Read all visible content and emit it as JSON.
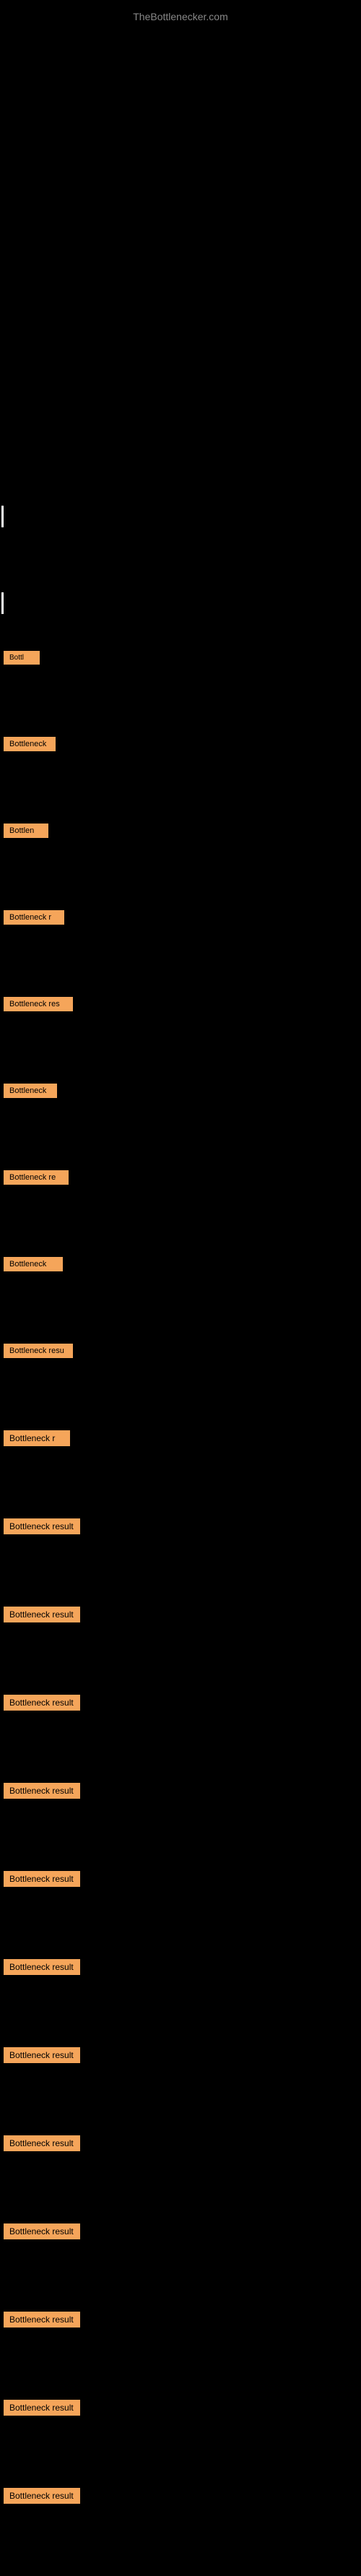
{
  "site": {
    "title": "TheBottlenecker.com"
  },
  "bottleneck_items": [
    {
      "id": 1,
      "label": "Bottl",
      "class": "item-1"
    },
    {
      "id": 2,
      "label": "Bottleneck",
      "class": "item-2"
    },
    {
      "id": 3,
      "label": "Bottlen",
      "class": "item-3"
    },
    {
      "id": 4,
      "label": "Bottleneck r",
      "class": "item-4"
    },
    {
      "id": 5,
      "label": "Bottleneck res",
      "class": "item-5"
    },
    {
      "id": 6,
      "label": "Bottleneck",
      "class": "item-6"
    },
    {
      "id": 7,
      "label": "Bottleneck re",
      "class": "item-7"
    },
    {
      "id": 8,
      "label": "Bottleneck",
      "class": "item-8"
    },
    {
      "id": 9,
      "label": "Bottleneck resu",
      "class": "item-9"
    },
    {
      "id": 10,
      "label": "Bottleneck r",
      "class": "item-10"
    },
    {
      "id": 11,
      "label": "Bottleneck result",
      "class": "item-11"
    },
    {
      "id": 12,
      "label": "Bottleneck result",
      "class": "item-12"
    },
    {
      "id": 13,
      "label": "Bottleneck result",
      "class": "item-13"
    },
    {
      "id": 14,
      "label": "Bottleneck result",
      "class": "item-14"
    },
    {
      "id": 15,
      "label": "Bottleneck result",
      "class": "item-15"
    },
    {
      "id": 16,
      "label": "Bottleneck result",
      "class": "item-16"
    },
    {
      "id": 17,
      "label": "Bottleneck result",
      "class": "item-17"
    },
    {
      "id": 18,
      "label": "Bottleneck result",
      "class": "item-18"
    },
    {
      "id": 19,
      "label": "Bottleneck result",
      "class": "item-19"
    },
    {
      "id": 20,
      "label": "Bottleneck result",
      "class": "item-20"
    },
    {
      "id": 21,
      "label": "Bottleneck result",
      "class": "item-21"
    },
    {
      "id": 22,
      "label": "Bottleneck result",
      "class": "item-22"
    }
  ],
  "colors": {
    "background": "#000000",
    "badge_bg": "#f5a55a",
    "badge_text": "#000000",
    "site_title": "#888888"
  }
}
